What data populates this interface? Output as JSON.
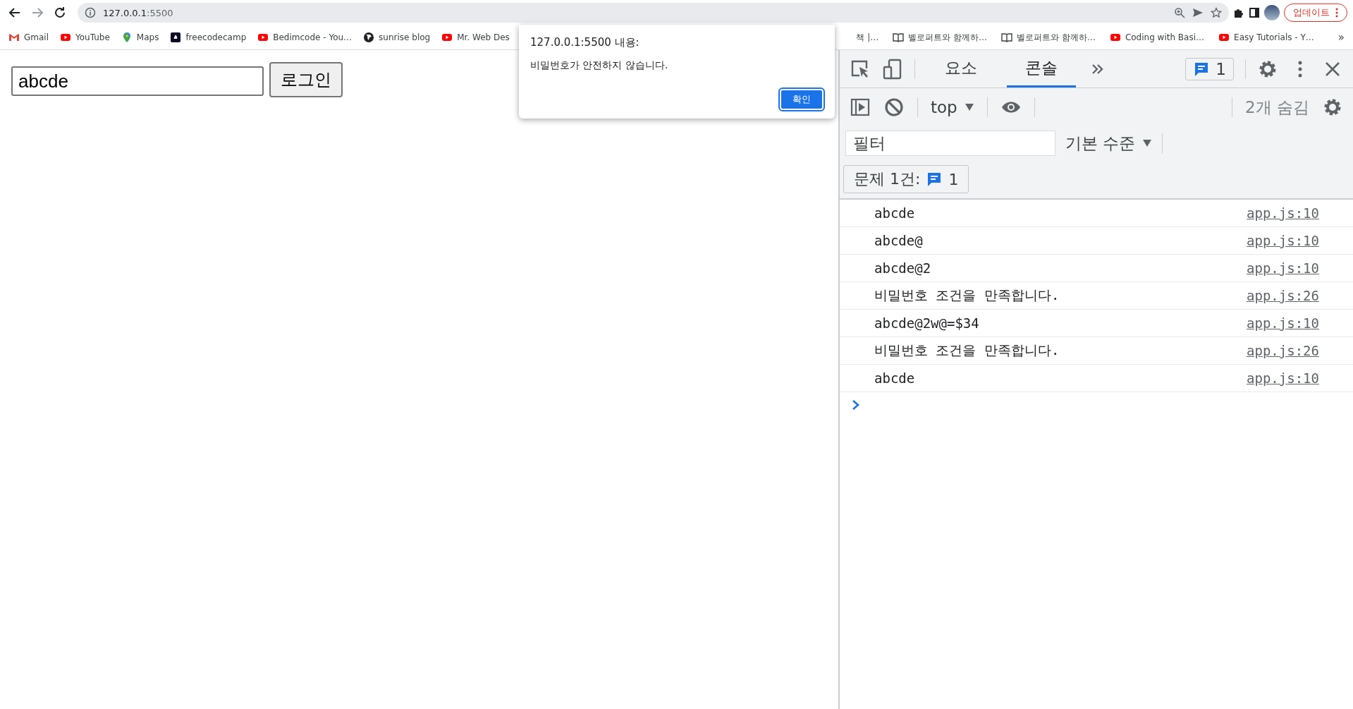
{
  "browser": {
    "url": {
      "host": "127.0.0.1",
      "port": ":5500"
    },
    "update_button": "업데이트"
  },
  "bookmarks_left": [
    {
      "kind": "mail",
      "label": "Gmail"
    },
    {
      "kind": "video",
      "label": "YouTube"
    },
    {
      "kind": "pin",
      "label": "Maps"
    },
    {
      "kind": "code",
      "label": "freecodecamp"
    },
    {
      "kind": "video",
      "label": "Bedimcode - You…"
    },
    {
      "kind": "globe",
      "label": "sunrise blog"
    },
    {
      "kind": "video",
      "label": "Mr. Web Des"
    }
  ],
  "bookmarks_right": [
    {
      "kind": "text",
      "label": "책 |…"
    },
    {
      "kind": "book",
      "label": "벨로퍼트와 함께하…"
    },
    {
      "kind": "book",
      "label": "벨로퍼트와 함께하…"
    },
    {
      "kind": "video",
      "label": "Coding with Basi…"
    },
    {
      "kind": "video",
      "label": "Easy Tutorials - Y…"
    }
  ],
  "bookmarks_more": "»",
  "page": {
    "input_value": "abcde",
    "login_button": "로그인"
  },
  "dialog": {
    "title": "127.0.0.1:5500 내용:",
    "message": "비밀번호가 안전하지 않습니다.",
    "ok_button": "확인"
  },
  "devtools": {
    "tabs": [
      {
        "label": "요소",
        "selected": false
      },
      {
        "label": "콘솔",
        "selected": true
      }
    ],
    "issues_count": "1",
    "context": "top",
    "hidden_count": "2개 숨김",
    "filter_placeholder": "필터",
    "level_select": "기본 수준",
    "issues_label": "문제 1건:",
    "issues_badge": "1",
    "console": [
      {
        "message": "abcde",
        "source": "app.js:10"
      },
      {
        "message": "abcde@",
        "source": "app.js:10"
      },
      {
        "message": "abcde@2",
        "source": "app.js:10"
      },
      {
        "message": "비밀번호 조건을 만족합니다.",
        "source": "app.js:26"
      },
      {
        "message": "abcde@2w@=$34",
        "source": "app.js:10"
      },
      {
        "message": "비밀번호 조건을 만족합니다.",
        "source": "app.js:26"
      },
      {
        "message": "abcde",
        "source": "app.js:10"
      }
    ]
  }
}
